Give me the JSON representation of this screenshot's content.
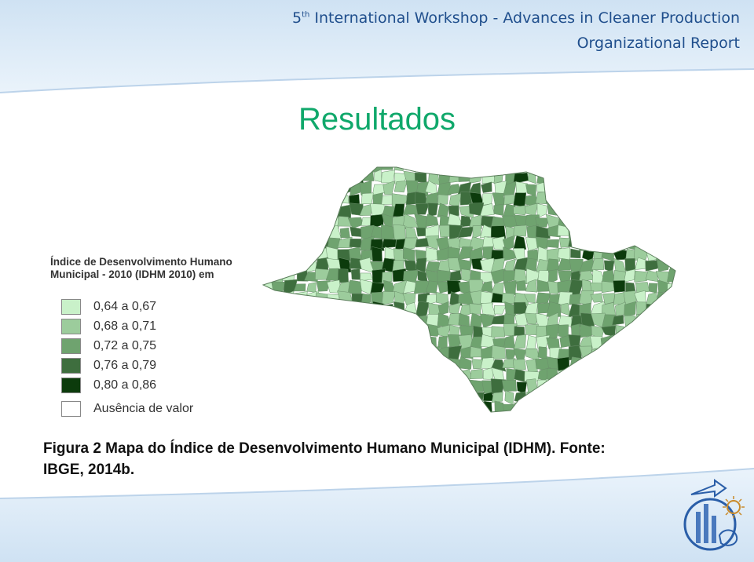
{
  "header": {
    "workshop_num": "5",
    "workshop_sup": "th",
    "workshop_rest": "International Workshop - Advances in Cleaner Production",
    "report": "Organizational Report"
  },
  "title": "Resultados",
  "legend": {
    "title_line1": "Índice de Desenvolvimento Humano",
    "title_line2": "Municipal - 2010 (IDHM 2010) em",
    "items": [
      {
        "label": "0,64 a 0,67",
        "color": "#c9f1c9"
      },
      {
        "label": "0,68 a 0,71",
        "color": "#9ccc9c"
      },
      {
        "label": "0,72 a 0,75",
        "color": "#6fa36f"
      },
      {
        "label": "0,76 a 0,79",
        "color": "#3e6e3e"
      },
      {
        "label": "0,80 a 0,86",
        "color": "#0c3b0c"
      },
      {
        "label": "Ausência de valor",
        "color": "#ffffff"
      }
    ]
  },
  "caption": {
    "line1": "Figura 2 Mapa do Índice de Desenvolvimento Humano Municipal (IDHM). Fonte:",
    "line2": "IBGE, 2014b."
  },
  "colors": {
    "title": "#10a86b",
    "header_text": "#1f4e8c",
    "band": "#dbe9f5"
  }
}
